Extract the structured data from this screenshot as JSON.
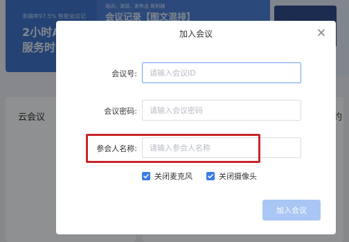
{
  "background": {
    "left_banner": {
      "small_text": "参编率97.5% 智能会议记",
      "big_text_line1": "2小时A",
      "big_text_line2": "服务时长"
    },
    "mid_banner": {
      "small_text": "培训、演讲、发布会 新利器",
      "big_text": "会议记录【图文混排】"
    },
    "cards": {
      "left_title": "云会议",
      "right_title": "预约"
    }
  },
  "dialog": {
    "title": "加入会议",
    "fields": {
      "meeting_id": {
        "label": "会议号:",
        "placeholder": "请输入会议ID"
      },
      "password": {
        "label": "会议密码:",
        "placeholder": "请输入会议密码"
      },
      "participant_name": {
        "label": "参会人名称:",
        "placeholder": "请输入参会人名称"
      }
    },
    "options": {
      "mute_mic": {
        "label": "关闭麦克风",
        "checked": true
      },
      "disable_camera": {
        "label": "关闭摄像头",
        "checked": true
      }
    },
    "join_button": "加入会议"
  },
  "colors": {
    "accent": "#3a7bea",
    "join_button_disabled": "#a9c6f4",
    "highlight": "#c8252a"
  }
}
